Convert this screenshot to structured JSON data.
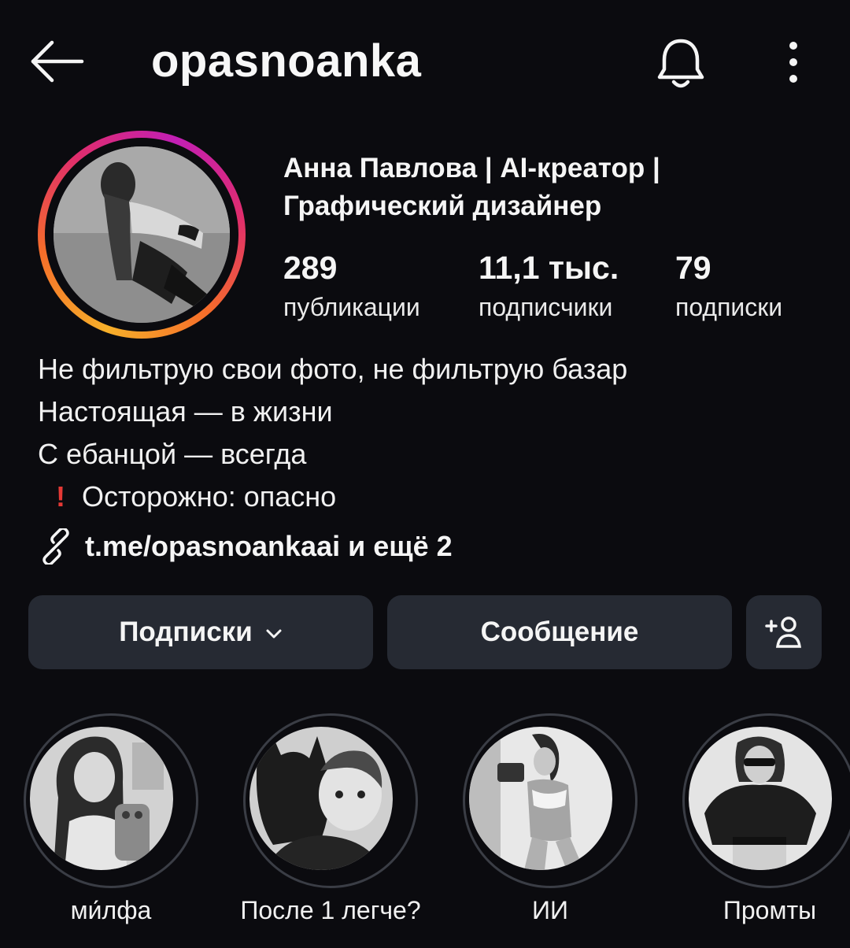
{
  "header": {
    "username": "opasnoanka",
    "back_icon": "arrow-left-icon",
    "bell_icon": "bell-icon",
    "more_icon": "more-vertical-icon"
  },
  "profile": {
    "display_name": "Анна Павлова | AI-креатор | Графический дизайнер",
    "avatar_ring_colors": [
      "#f7b02a",
      "#e02d6c",
      "#c21fb5"
    ]
  },
  "stats": {
    "posts": {
      "value": "289",
      "label": "публикации"
    },
    "followers": {
      "value": "11,1 тыс.",
      "label": "подписчики"
    },
    "following": {
      "value": "79",
      "label": "подписки"
    }
  },
  "bio": {
    "lines": [
      "Не фильтрую свои фото, не фильтрую базар",
      "Настоящая — в жизни",
      "С eбанцой — всегда"
    ],
    "warning_glyph": "!",
    "warning_text": "Осторожно: опасно",
    "link_icon": "link-icon",
    "link_text": "t.me/opasnoankaai и ещё 2"
  },
  "actions": {
    "following_label": "Подписки",
    "message_label": "Сообщение",
    "suggest_icon": "add-person-icon",
    "button_bg": "#262a33"
  },
  "highlights": [
    {
      "label": "ми́лфа"
    },
    {
      "label": "После 1 легче?"
    },
    {
      "label": "ИИ"
    },
    {
      "label": "Промты"
    }
  ],
  "colors": {
    "background": "#0b0b0f",
    "text": "#f5f5f5",
    "warning": "#e53935"
  }
}
